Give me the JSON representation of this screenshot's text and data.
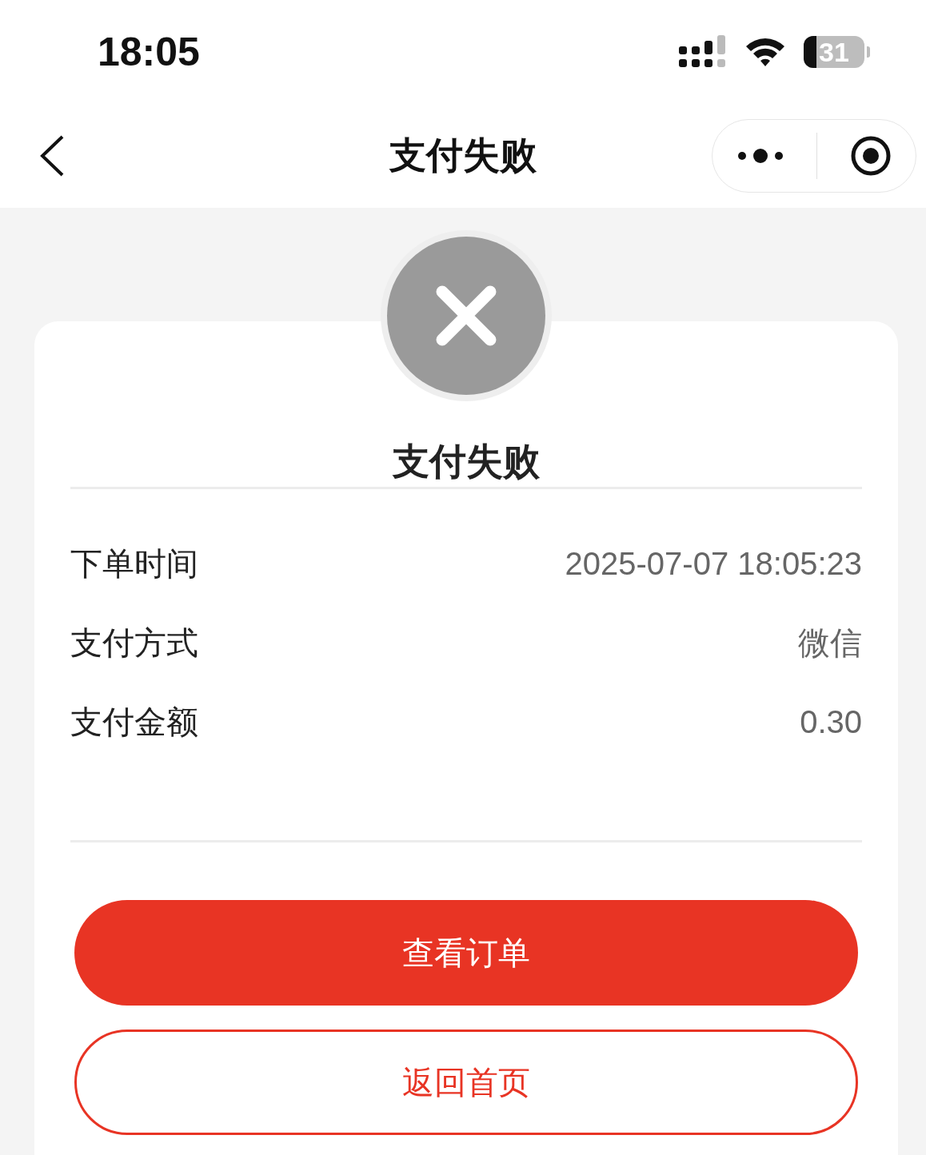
{
  "status_bar": {
    "time": "18:05",
    "battery": "31"
  },
  "nav_bar": {
    "title": "支付失败"
  },
  "result": {
    "title": "支付失败"
  },
  "details": [
    {
      "label": "下单时间",
      "value": "2025-07-07 18:05:23"
    },
    {
      "label": "支付方式",
      "value": "微信"
    },
    {
      "label": "支付金额",
      "value": "0.30"
    }
  ],
  "buttons": [
    {
      "label": "查看订单",
      "kind": "primary"
    },
    {
      "label": "返回首页",
      "kind": "outline"
    }
  ]
}
